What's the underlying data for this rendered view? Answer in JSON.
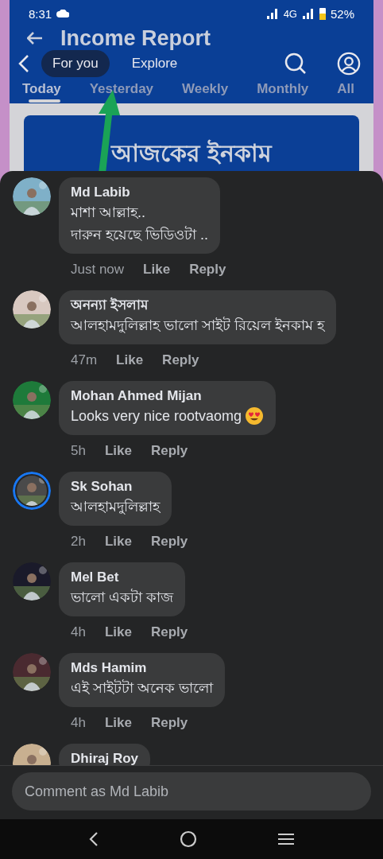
{
  "status_bar": {
    "time": "8:31",
    "network": "4G",
    "battery": "52%"
  },
  "app": {
    "title": "Income Report",
    "period_tabs": [
      {
        "label": "Today",
        "selected": true
      },
      {
        "label": "Yesterday",
        "selected": false
      },
      {
        "label": "Weekly",
        "selected": false
      },
      {
        "label": "Monthly",
        "selected": false
      },
      {
        "label": "All",
        "selected": false
      }
    ],
    "card_title": "আজকের ইনকাম"
  },
  "overlay_tabs": [
    {
      "label": "For you",
      "selected": true
    },
    {
      "label": "Explore",
      "selected": false
    }
  ],
  "comments": [
    {
      "name": "Md Labib",
      "lines": [
        "মাশা আল্লাহ..",
        "দারুন হয়েছে ভিডিওটা .."
      ],
      "time": "Just now",
      "like": "Like",
      "reply": "Reply",
      "story_ring": false,
      "emoji": false
    },
    {
      "name": "অনন্যা ইসলাম",
      "lines": [
        "আলহামদুলিল্লাহ ভালো সাইট রিয়েল ইনকাম হ"
      ],
      "time": "47m",
      "like": "Like",
      "reply": "Reply",
      "story_ring": false,
      "emoji": false
    },
    {
      "name": "Mohan Ahmed Mijan",
      "lines": [
        "Looks very nice rootvaomg"
      ],
      "time": "5h",
      "like": "Like",
      "reply": "Reply",
      "story_ring": false,
      "emoji": true
    },
    {
      "name": "Sk Sohan",
      "lines": [
        "আলহামদুলিল্লাহ"
      ],
      "time": "2h",
      "like": "Like",
      "reply": "Reply",
      "story_ring": true,
      "emoji": false
    },
    {
      "name": "Mel Bet",
      "lines": [
        "ভালো একটা কাজ"
      ],
      "time": "4h",
      "like": "Like",
      "reply": "Reply",
      "story_ring": false,
      "emoji": false
    },
    {
      "name": "Mds Hamim",
      "lines": [
        "এই সাইটটা অনেক ভালো"
      ],
      "time": "4h",
      "like": "Like",
      "reply": "Reply",
      "story_ring": false,
      "emoji": false
    },
    {
      "name": "Dhiraj Roy",
      "story_ring": false
    }
  ],
  "comment_field": {
    "placeholder": "Comment as Md Labib"
  }
}
